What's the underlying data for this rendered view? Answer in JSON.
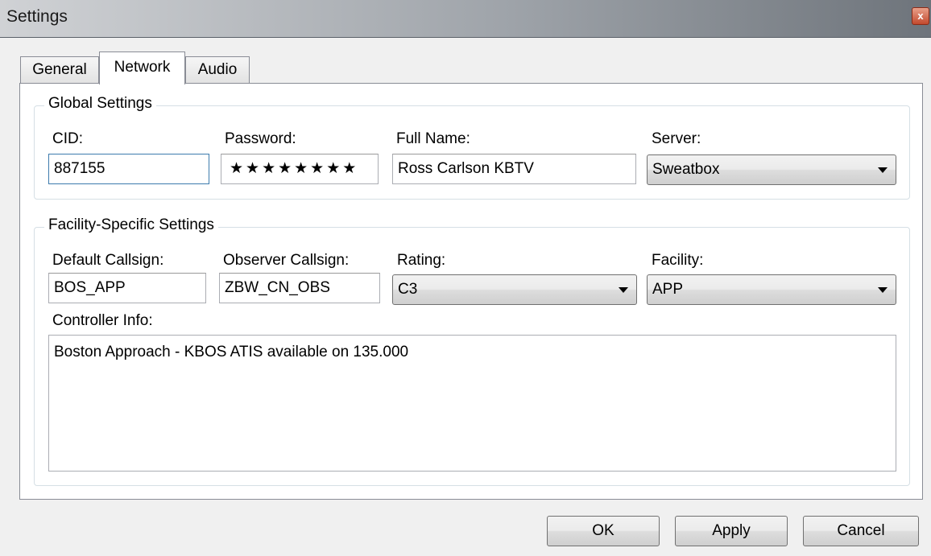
{
  "window": {
    "title": "Settings",
    "close_glyph": "x"
  },
  "tabs": [
    {
      "label": "General"
    },
    {
      "label": "Network"
    },
    {
      "label": "Audio"
    }
  ],
  "global": {
    "title": "Global Settings",
    "cid_label": "CID:",
    "cid_value": "887155",
    "password_label": "Password:",
    "password_value": "★★★★★★★★",
    "fullname_label": "Full Name:",
    "fullname_value": "Ross Carlson KBTV",
    "server_label": "Server:",
    "server_value": "Sweatbox"
  },
  "facility": {
    "title": "Facility-Specific Settings",
    "default_callsign_label": "Default Callsign:",
    "default_callsign_value": "BOS_APP",
    "observer_callsign_label": "Observer Callsign:",
    "observer_callsign_value": "ZBW_CN_OBS",
    "rating_label": "Rating:",
    "rating_value": "C3",
    "facility_label": "Facility:",
    "facility_value": "APP",
    "controller_info_label": "Controller Info:",
    "controller_info_value": "Boston Approach - KBOS ATIS available on 135.000"
  },
  "buttons": {
    "ok": "OK",
    "apply": "Apply",
    "cancel": "Cancel"
  }
}
